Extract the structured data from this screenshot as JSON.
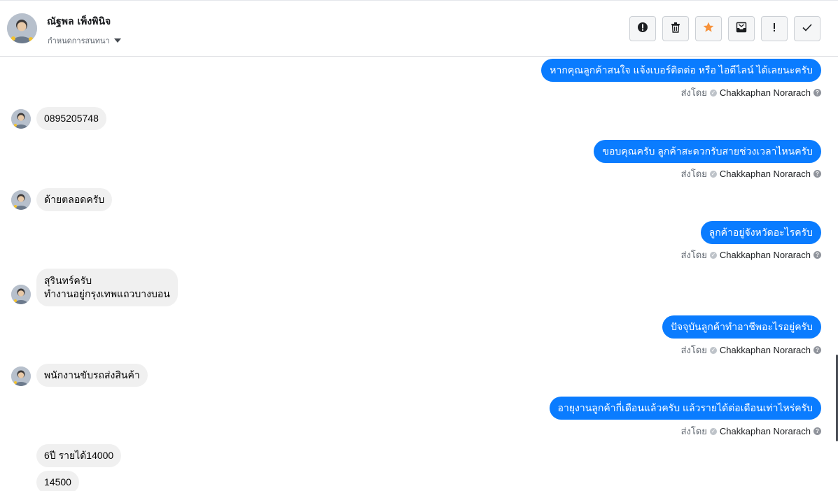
{
  "header": {
    "contact_name": "ณัฐพล เพ็งพินิจ",
    "assign_label": "กำหนดการสนทนา",
    "actions": [
      {
        "name": "report-spam-button",
        "icon": "alert-circle-icon"
      },
      {
        "name": "delete-button",
        "icon": "trash-icon"
      },
      {
        "name": "star-button",
        "icon": "star-icon",
        "color": "#f7923b"
      },
      {
        "name": "mark-unread-button",
        "icon": "inbox-icon"
      },
      {
        "name": "flag-button",
        "icon": "exclamation-icon"
      },
      {
        "name": "mark-done-button",
        "icon": "check-icon"
      }
    ]
  },
  "colors": {
    "outgoing": "#0a7cff",
    "incoming": "#f0f0f0"
  },
  "sent_by": {
    "prefix": "ส่งโดย",
    "agent": "Chakkaphan Norarach"
  },
  "messages": [
    {
      "dir": "out",
      "text": "หากคุณลูกค้าสนใจ แจ้งเบอร์ติดต่อ หรือ ไอดีไลน์ ได้เลยนะครับ"
    },
    {
      "dir": "in",
      "text": "0895205748"
    },
    {
      "dir": "out",
      "text": "ขอบคุณครับ ลูกค้าสะดวกรับสายช่วงเวลาไหนครับ"
    },
    {
      "dir": "in",
      "text": "ด้ายตลอดครับ"
    },
    {
      "dir": "out",
      "text": "ลูกค้าอยู่จังหวัดอะไรครับ"
    },
    {
      "dir": "in",
      "line1": "สุรินทร์ครับ",
      "line2": "ทำงานอยู่กรุงเทพแถวบางบอน"
    },
    {
      "dir": "out",
      "text": "ปัจจุบันลูกค้าทำอาชีพอะไรอยู่ครับ"
    },
    {
      "dir": "in",
      "text": "พนักงานขับรถส่งสินค้า"
    },
    {
      "dir": "out",
      "text": "อายุงานลูกค้ากี่เดือนแล้วครับ แล้วรายได้ต่อเดือนเท่าไหร่ครับ"
    },
    {
      "dir": "in",
      "text": "6ปี รายได้14000"
    },
    {
      "dir": "in",
      "text": "14500"
    }
  ]
}
